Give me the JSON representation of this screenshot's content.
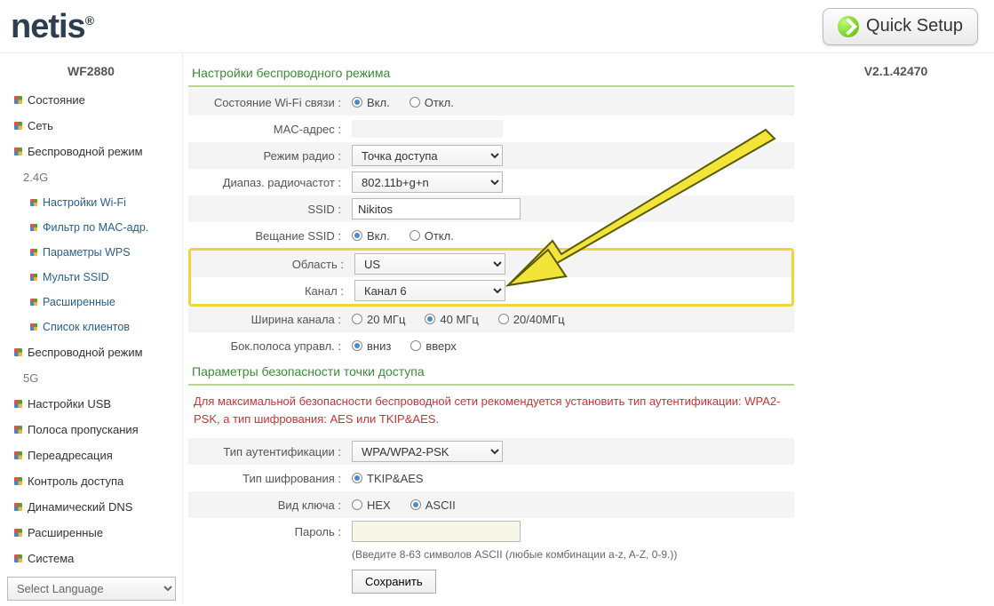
{
  "header": {
    "logo": "netis",
    "quick_setup": "Quick Setup"
  },
  "sidebar": {
    "model": "WF2880",
    "items": [
      {
        "label": "Состояние",
        "type": "top"
      },
      {
        "label": "Сеть",
        "type": "top"
      },
      {
        "label": "Беспроводной режим",
        "type": "top"
      },
      {
        "label": "2.4G",
        "type": "label"
      },
      {
        "label": "Настройки Wi-Fi",
        "type": "sub"
      },
      {
        "label": "Фильтр по MAC-адр.",
        "type": "sub"
      },
      {
        "label": "Параметры WPS",
        "type": "sub"
      },
      {
        "label": "Мульти SSID",
        "type": "sub"
      },
      {
        "label": "Расширенные",
        "type": "sub"
      },
      {
        "label": "Список клиентов",
        "type": "sub"
      },
      {
        "label": "Беспроводной режим",
        "type": "top"
      },
      {
        "label": "5G",
        "type": "label"
      },
      {
        "label": "Настройки USB",
        "type": "top"
      },
      {
        "label": "Полоса пропускания",
        "type": "top"
      },
      {
        "label": "Переадресация",
        "type": "top"
      },
      {
        "label": "Контроль доступа",
        "type": "top"
      },
      {
        "label": "Динамический DNS",
        "type": "top"
      },
      {
        "label": "Расширенные",
        "type": "top"
      },
      {
        "label": "Система",
        "type": "top"
      }
    ],
    "lang_placeholder": "Select Language"
  },
  "main": {
    "section_wifi": "Настройки беспроводного режима",
    "rows": {
      "state_lbl": "Состояние Wi-Fi связи :",
      "state_on": "Вкл.",
      "state_off": "Откл.",
      "mac_lbl": "MAC-адрес :",
      "mac_val": "",
      "radio_mode_lbl": "Режим радио :",
      "radio_mode_val": "Точка доступа",
      "band_lbl": "Диапаз. радиочастот :",
      "band_val": "802.11b+g+n",
      "ssid_lbl": "SSID :",
      "ssid_val": "Nikitos",
      "ssid_bcast_lbl": "Вещание SSID :",
      "ssid_bcast_on": "Вкл.",
      "ssid_bcast_off": "Откл.",
      "region_lbl": "Область :",
      "region_val": "US",
      "channel_lbl": "Канал :",
      "channel_val": "Канал 6",
      "cw_lbl": "Ширина канала :",
      "cw_20": "20 МГц",
      "cw_40": "40 МГц",
      "cw_2040": "20/40МГц",
      "sb_lbl": "Бок.полоса управл. :",
      "sb_down": "вниз",
      "sb_up": "вверх"
    },
    "section_sec": "Параметры безопасности точки доступа",
    "note": "Для максимальной безопасности беспроводной сети рекомендуется установить тип аутентификации: WPA2-PSK, а тип шифрования: AES или TKIP&AES.",
    "sec": {
      "auth_lbl": "Тип аутентификации :",
      "auth_val": "WPA/WPA2-PSK",
      "enc_lbl": "Тип шифрования :",
      "enc_val": "TKIP&AES",
      "key_lbl": "Вид ключа :",
      "key_hex": "HEX",
      "key_ascii": "ASCII",
      "pass_lbl": "Пароль :",
      "pass_val": "",
      "hint": "(Введите 8-63 символов ASCII (любые комбинации a-z, A-Z, 0-9.))",
      "save": "Сохранить"
    }
  },
  "right": {
    "version": "V2.1.42470"
  }
}
